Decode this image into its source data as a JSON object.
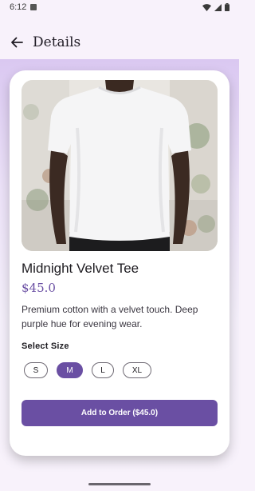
{
  "status_bar": {
    "time": "6:12"
  },
  "app_bar": {
    "title": "Details"
  },
  "product": {
    "name": "Midnight Velvet Tee",
    "price": "$45.0",
    "description": "Premium cotton with a velvet touch. Deep purple hue for evening wear.",
    "image_icon": "t-shirt-photo"
  },
  "sizes": {
    "label": "Select Size",
    "options": [
      "S",
      "M",
      "L",
      "XL"
    ],
    "selected": "M"
  },
  "actions": {
    "add_to_order": "Add to Order ($45.0)"
  },
  "colors": {
    "primary": "#6a4fa3",
    "background": "#f8f2fb",
    "card": "#ffffff"
  }
}
